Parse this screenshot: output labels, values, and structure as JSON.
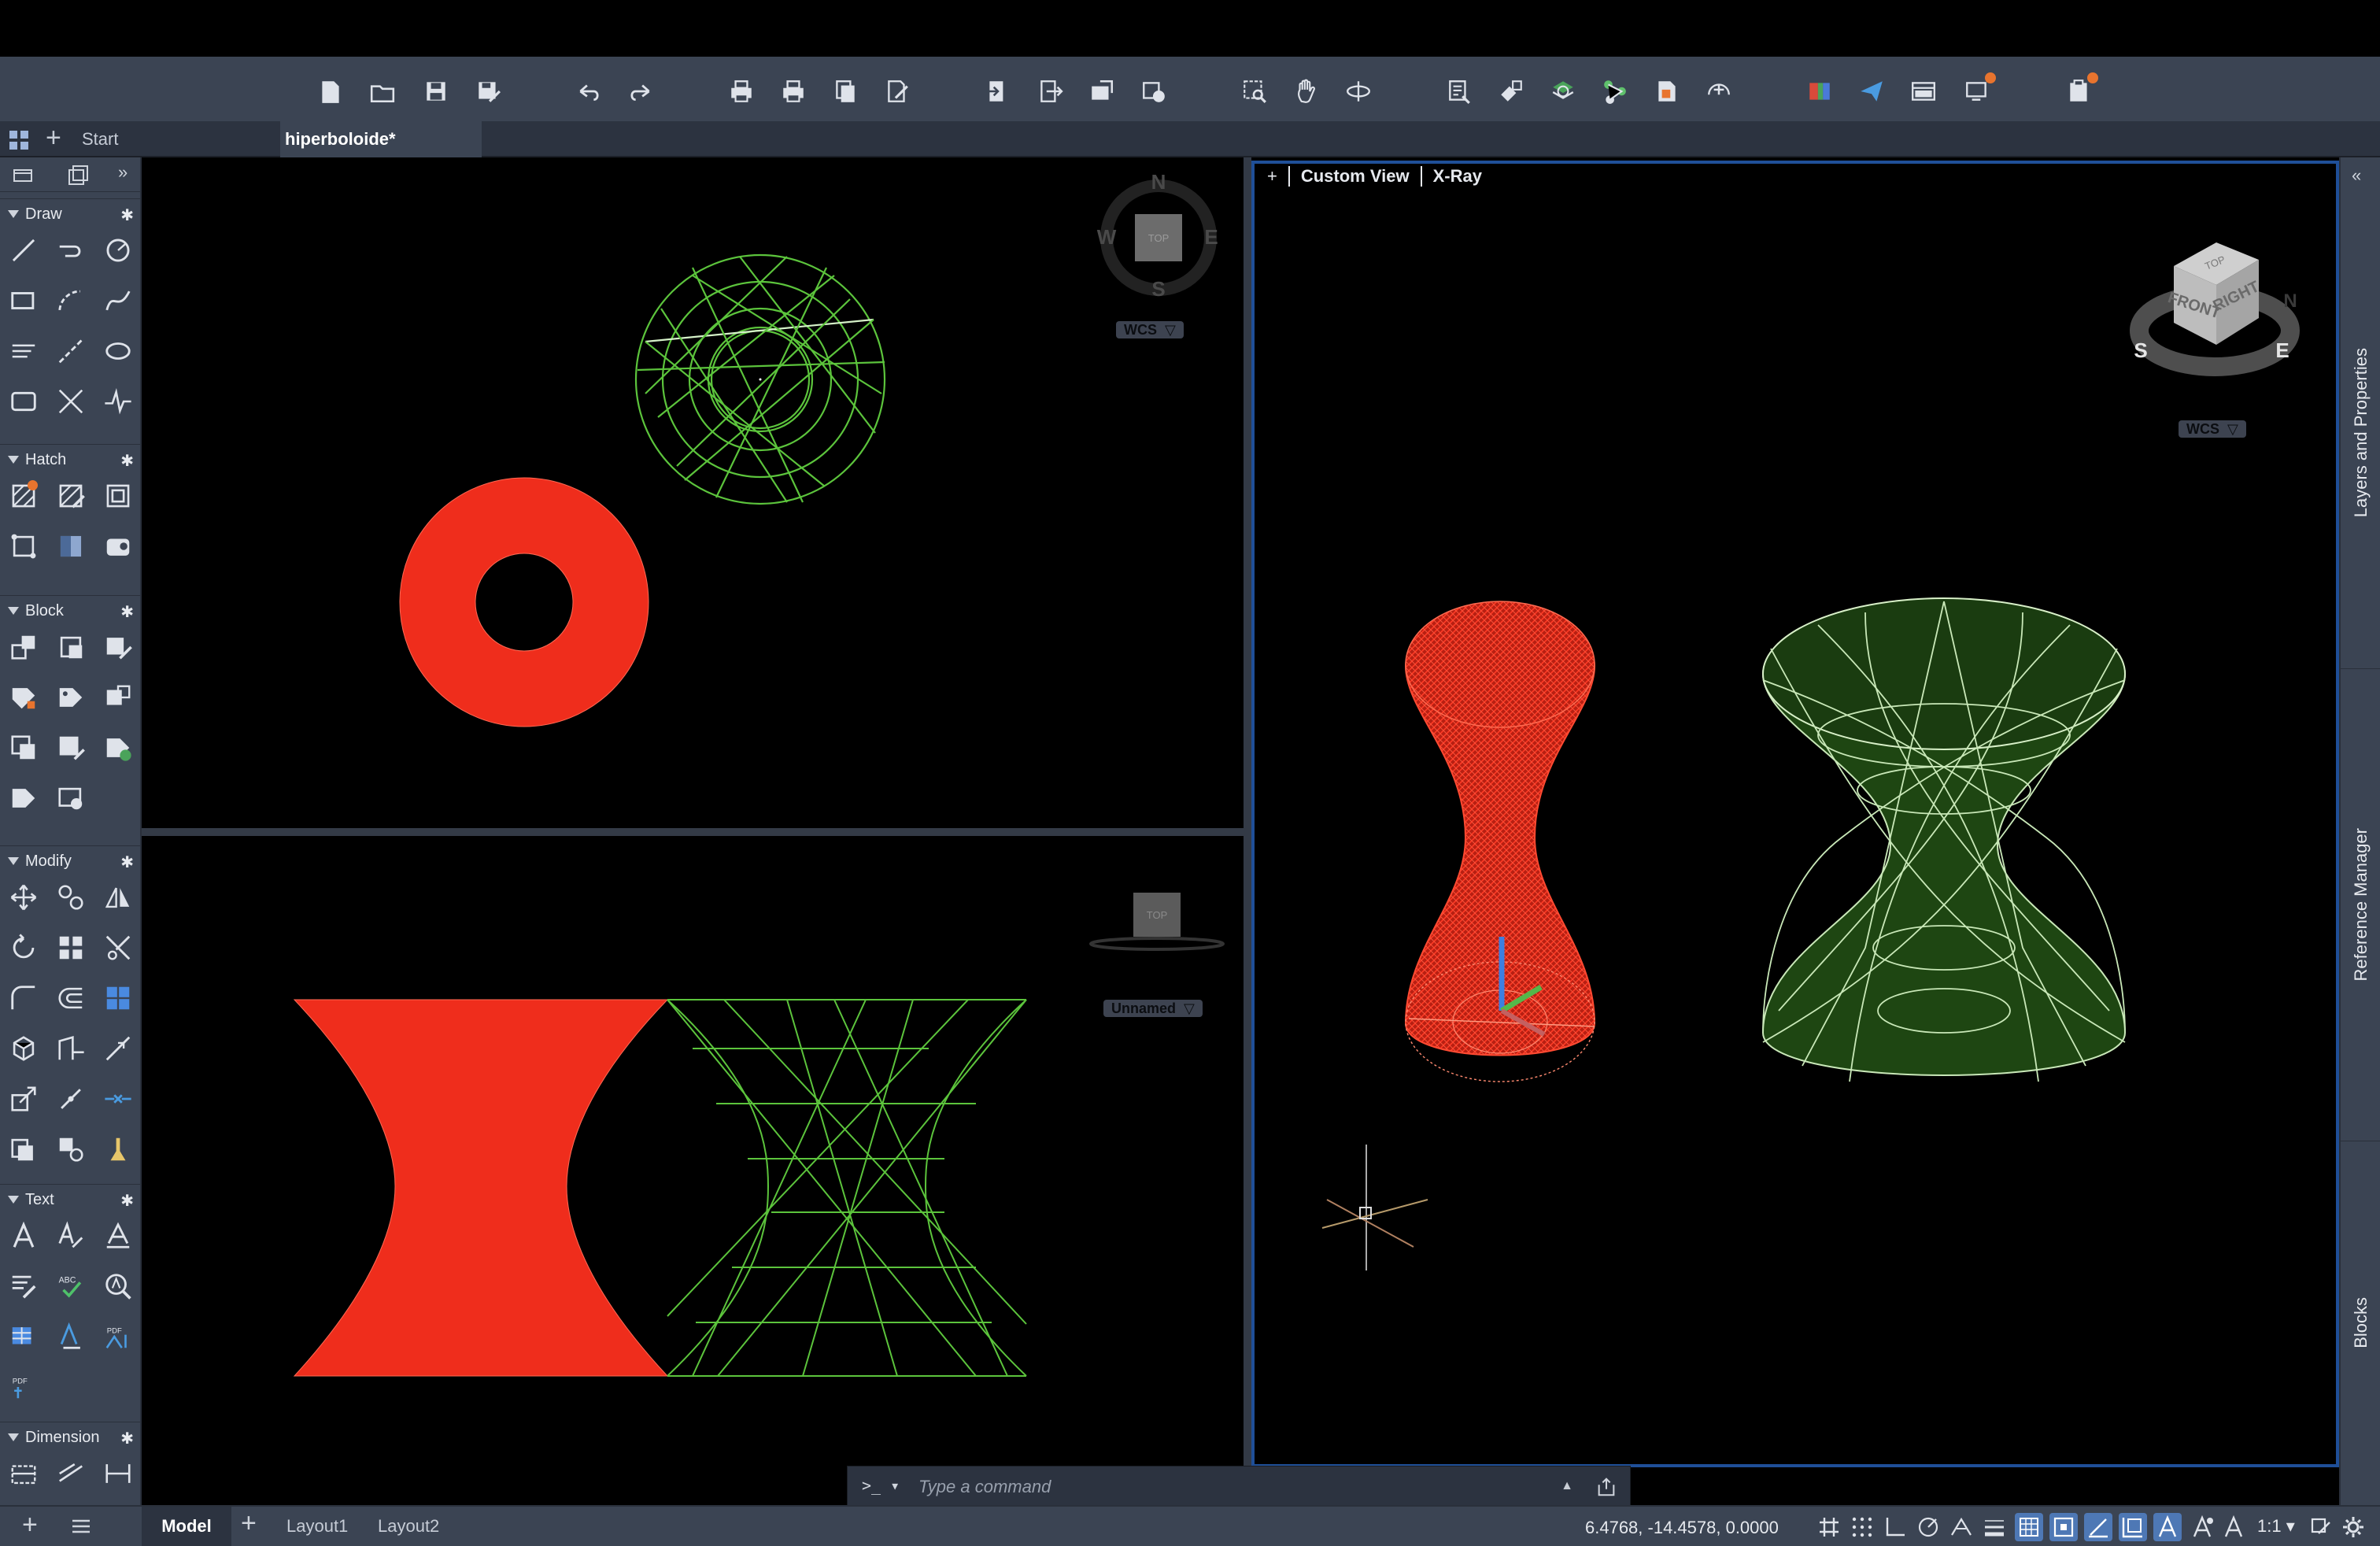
{
  "tabs": {
    "start_label": "Start",
    "document_label": "hiperboloide*"
  },
  "toolbar": {
    "icons": [
      "new-icon",
      "open-icon",
      "save-icon",
      "save-as-icon",
      "undo-icon",
      "redo-icon",
      "plot-icon",
      "plot-preview-icon",
      "publish-icon",
      "batch-plot-icon",
      "import-icon",
      "export-icon",
      "share-icon",
      "web-icon",
      "zoom-window-icon",
      "pan-icon",
      "orbit-icon",
      "properties-icon",
      "match-properties-icon",
      "layer-icon",
      "xref-icon",
      "block-icon",
      "quickcalc-icon",
      "color-icon",
      "send-icon",
      "workspace-icon",
      "notifications-icon",
      "updates-icon"
    ]
  },
  "palette": {
    "sections": [
      {
        "label": "Draw"
      },
      {
        "label": "Hatch"
      },
      {
        "label": "Block"
      },
      {
        "label": "Modify"
      },
      {
        "label": "Text"
      },
      {
        "label": "Dimension"
      }
    ]
  },
  "viewports": {
    "top_left": {
      "compass": {
        "n": "N",
        "s": "S",
        "e": "E",
        "w": "W",
        "face": "TOP"
      },
      "ucs_label": "WCS"
    },
    "bottom_left": {
      "face": "TOP",
      "ucs_label": "Unnamed"
    },
    "right": {
      "plus": "+",
      "view_label": "Custom View",
      "style_label": "X-Ray",
      "viewcube": {
        "front": "FRONT",
        "right": "RIGHT",
        "top": "TOP",
        "s": "S",
        "e": "E",
        "n": "N"
      },
      "ucs_label": "WCS"
    }
  },
  "colors": {
    "red_surface": "#ff2a1a",
    "green_wire": "#6ed44a",
    "green_fill": "#1e4612",
    "active_border": "#1f4f98",
    "panel": "#3b4453"
  },
  "rightpanel": {
    "items": [
      {
        "label": "Layers and Properties"
      },
      {
        "label": "Reference Manager"
      },
      {
        "label": "Blocks"
      }
    ]
  },
  "commandline": {
    "prompt": ">_",
    "placeholder": "Type a command"
  },
  "statusbar": {
    "model_tab": "Model",
    "layout_tabs": [
      "Layout1",
      "Layout2"
    ],
    "coordinates": "6.4768, -14.4578, 0.0000",
    "scale": "1:1"
  }
}
